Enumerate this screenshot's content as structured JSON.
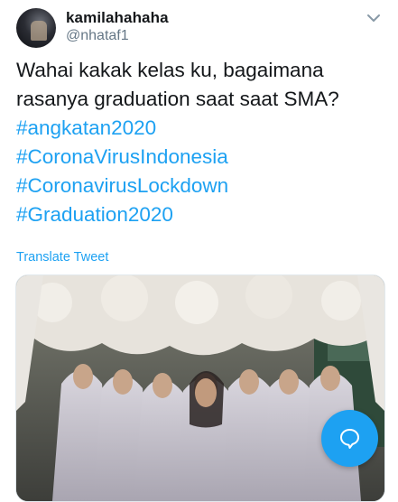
{
  "tweet": {
    "display_name": "kamilahahaha",
    "handle": "@nhataf1",
    "lines": [
      "Wahai kakak kelas ku, bagaimana",
      "rasanya graduation saat saat SMA?"
    ],
    "hashtags": [
      "#angkatan2020",
      "#CoronaVirusIndonesia",
      "#CoronavirusLockdown",
      "#Graduation2020"
    ],
    "translate_label": "Translate Tweet"
  },
  "icons": {
    "caret": "chevron-down-icon",
    "compose": "chat-bubble-icon"
  },
  "colors": {
    "accent": "#1da1f2",
    "secondary_text": "#657786"
  }
}
